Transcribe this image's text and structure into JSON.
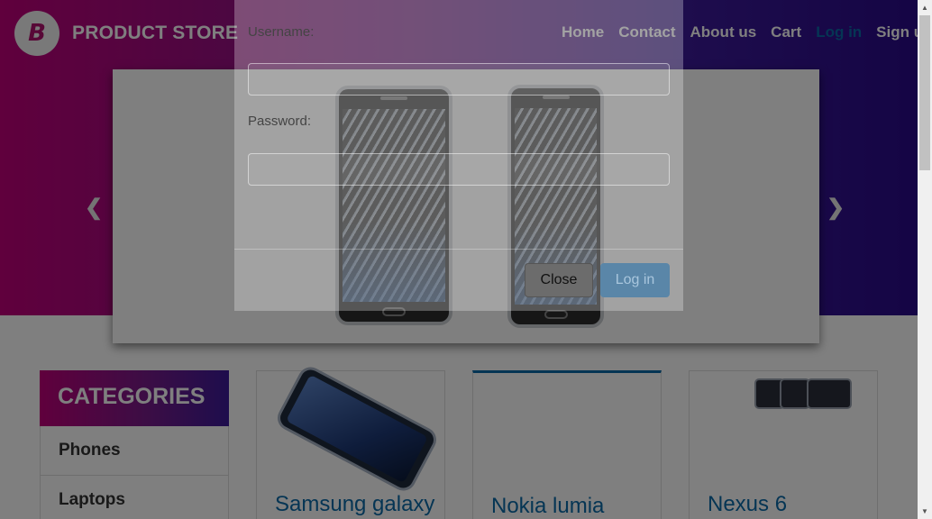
{
  "brand": {
    "name": "PRODUCT STORE",
    "logo_letter": "B"
  },
  "nav": {
    "items": [
      {
        "label": "Home"
      },
      {
        "label": "Contact"
      },
      {
        "label": "About us"
      },
      {
        "label": "Cart"
      },
      {
        "label": "Log in"
      },
      {
        "label": "Sign up"
      }
    ]
  },
  "carousel": {
    "prev_icon": "chevron-left-icon",
    "next_icon": "chevron-right-icon",
    "prev_glyph": "❮",
    "next_glyph": "❯"
  },
  "categories": {
    "header": "CATEGORIES",
    "items": [
      {
        "label": "Phones"
      },
      {
        "label": "Laptops"
      }
    ]
  },
  "products": [
    {
      "title": "Samsung galaxy"
    },
    {
      "title": "Nokia lumia"
    },
    {
      "title": "Nexus 6"
    }
  ],
  "login_modal": {
    "username_label": "Username:",
    "password_label": "Password:",
    "close_label": "Close",
    "login_label": "Log in"
  },
  "colors": {
    "brand_pink": "#c0007a",
    "brand_purple": "#3c1a9a",
    "link_blue": "#0a6aa8"
  }
}
